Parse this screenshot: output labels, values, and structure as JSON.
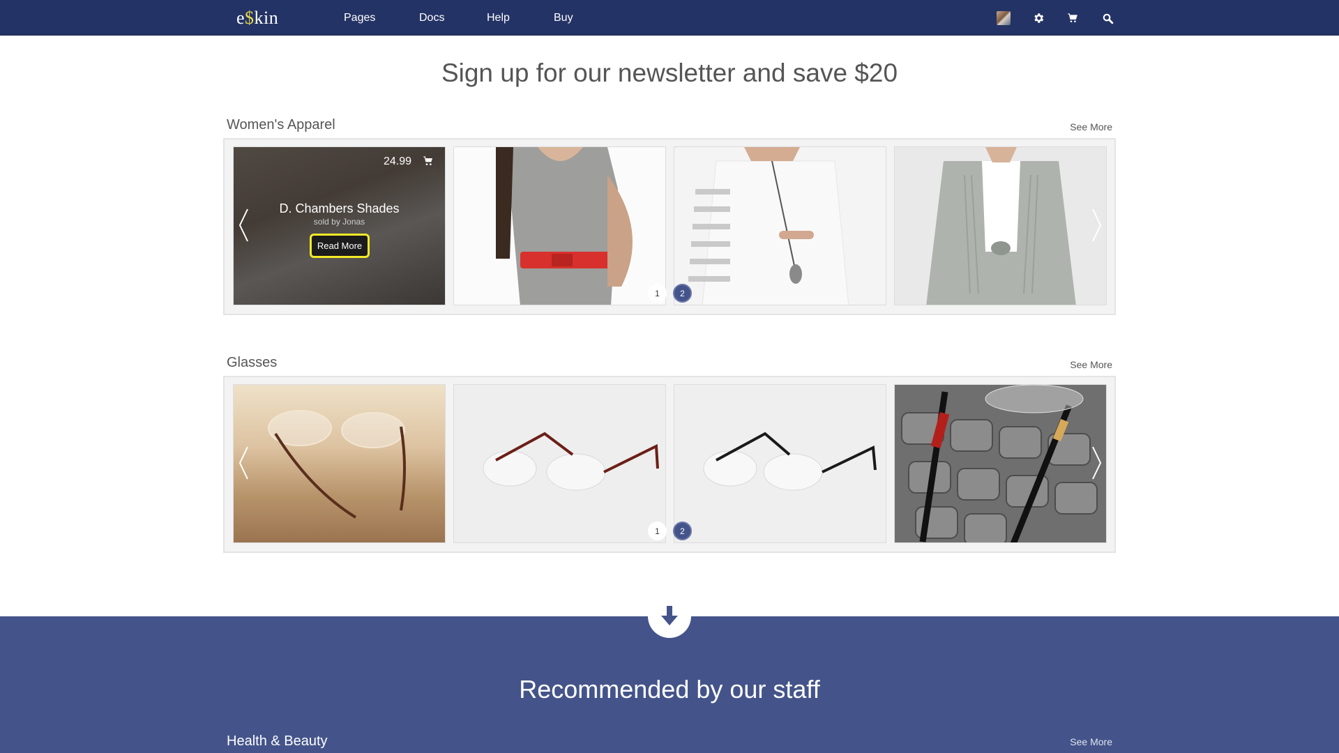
{
  "brand": {
    "logo_prefix": "e",
    "logo_dollar": "$",
    "logo_suffix": "kin"
  },
  "nav": {
    "links": [
      "Pages",
      "Docs",
      "Help",
      "Buy"
    ],
    "icons": [
      "avatar",
      "gear-icon",
      "cart-icon",
      "search-icon"
    ]
  },
  "hero": {
    "title": "Sign up for our newsletter and save $20"
  },
  "sections": [
    {
      "title": "Women's Apparel",
      "see_more": "See More",
      "featured": {
        "price": "24.99",
        "name": "D. Chambers Shades",
        "seller": "sold by Jonas",
        "cta": "Read More"
      },
      "pager": [
        "1",
        "2"
      ],
      "active_page": 2
    },
    {
      "title": "Glasses",
      "see_more": "See More",
      "pager": [
        "1",
        "2"
      ],
      "active_page": 2
    }
  ],
  "recommended": {
    "title": "Recommended by our staff",
    "section_title": "Health & Beauty",
    "see_more": "See More"
  },
  "colors": {
    "navbar": "#243365",
    "band": "#44548a",
    "accent_yellow": "#f4ea26"
  }
}
